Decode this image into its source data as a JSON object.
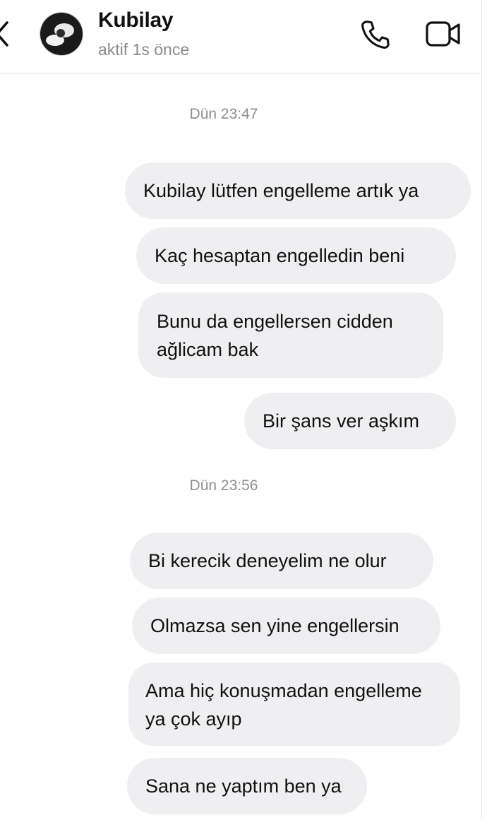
{
  "header": {
    "contact_name": "Kubilay",
    "status": "aktif 1s önce",
    "back_icon": "chevron-left-icon",
    "call_icon": "phone-icon",
    "video_icon": "video-camera-icon"
  },
  "conversation": {
    "groups": [
      {
        "timestamp": "Dün 23:47",
        "messages": [
          "Kubilay lütfen engelleme artık ya",
          "Kaç hesaptan engelledin beni",
          [
            "Bunu da engellersen cidden",
            "ağlicam bak"
          ],
          "Bir şans ver aşkım"
        ]
      },
      {
        "timestamp": "Dün 23:56",
        "messages": [
          "Bi kerecik deneyelim ne olur",
          "Olmazsa sen yine engellersin",
          [
            "Ama hiç konuşmadan engelleme",
            "ya çok ayıp"
          ],
          "Sana ne yaptım ben ya"
        ]
      }
    ]
  },
  "colors": {
    "bubble": "#efeff1",
    "timestamp": "#8e8e8e",
    "status": "#8a8a8a"
  }
}
